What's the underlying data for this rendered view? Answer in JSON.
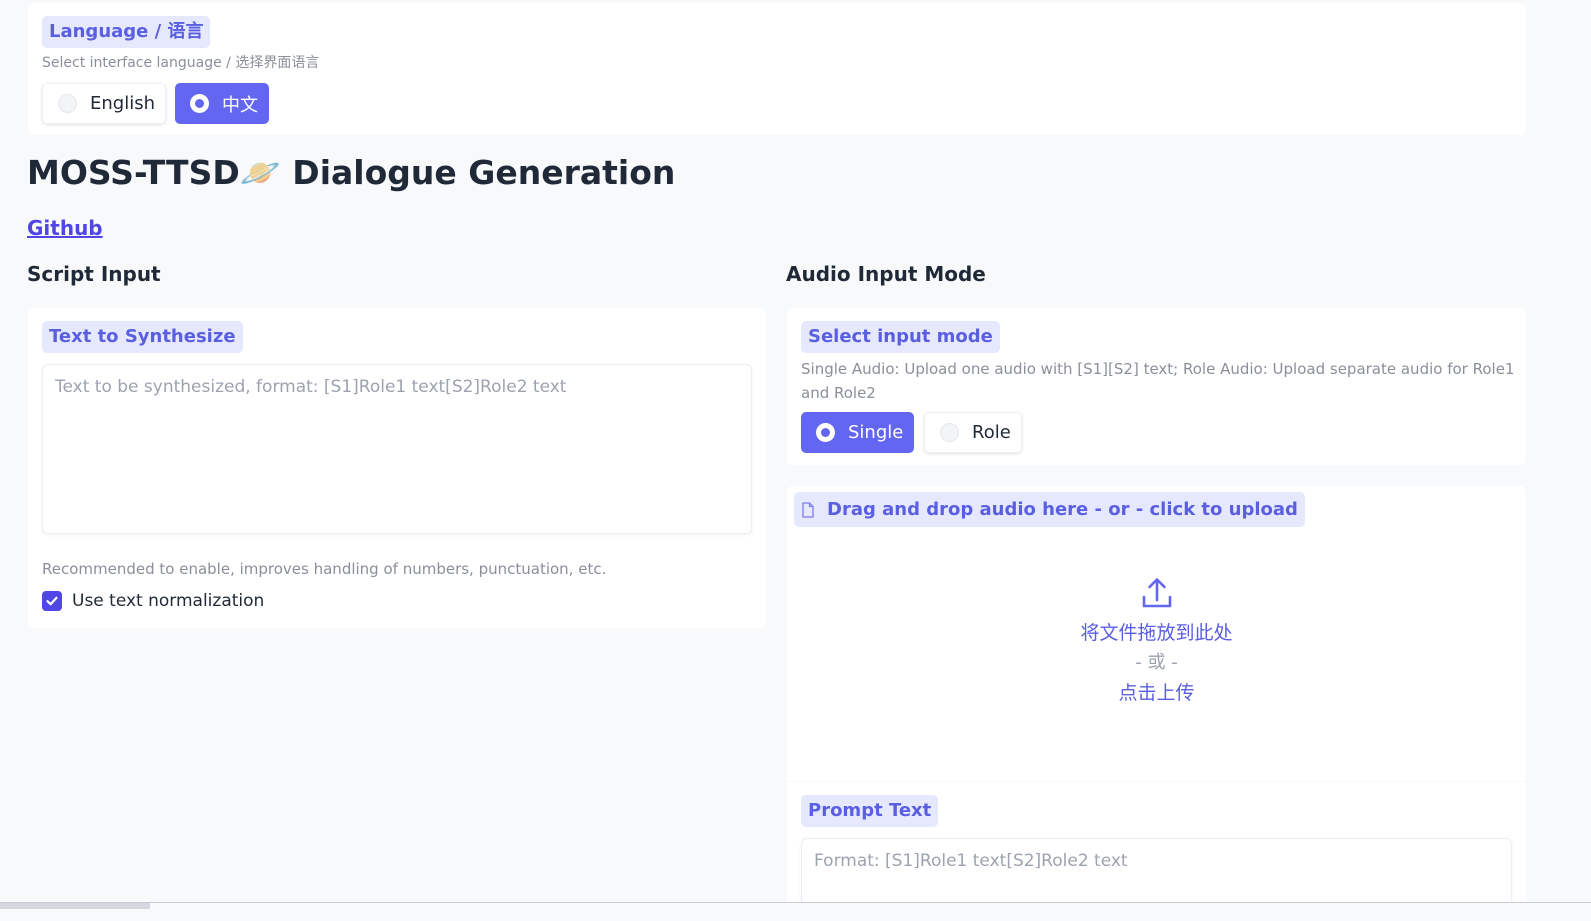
{
  "language": {
    "label": "Language / 语言",
    "info": "Select interface language / 选择界面语言",
    "options": [
      "English",
      "中文"
    ],
    "selected": "中文"
  },
  "page": {
    "title": "MOSS-TTSD🪐 Dialogue Generation",
    "github_link": "Github"
  },
  "script": {
    "heading": "Script Input",
    "text_label": "Text to Synthesize",
    "text_placeholder": "Text to be synthesized, format: [S1]Role1 text[S2]Role2 text",
    "normalize_info": "Recommended to enable, improves handling of numbers, punctuation, etc.",
    "normalize_label": "Use text normalization",
    "normalize_checked": true
  },
  "audio": {
    "heading": "Audio Input Mode",
    "mode_label": "Select input mode",
    "mode_info": "Single Audio: Upload one audio with [S1][S2] text; Role Audio: Upload separate audio for Role1 and Role2",
    "mode_options": [
      "Single",
      "Role"
    ],
    "mode_selected": "Single",
    "upload_label": "Drag and drop audio here - or - click to upload",
    "drop_text": "将文件拖放到此处",
    "or_text": "- 或 -",
    "click_text": "点击上传",
    "prompt_label": "Prompt Text",
    "prompt_placeholder": "Format: [S1]Role1 text[S2]Role2 text"
  },
  "colors": {
    "accent": "#6366f1",
    "label_bg": "#e6e8fd",
    "label_fg": "#5a5ee0"
  }
}
